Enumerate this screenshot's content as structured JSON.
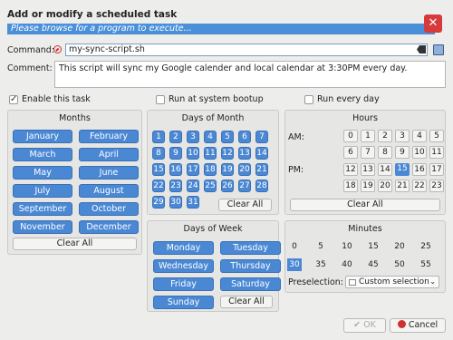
{
  "dialog": {
    "title": "Add or modify a scheduled task",
    "subtitle": "Please browse for a program to execute..."
  },
  "command": {
    "label": "Command:",
    "value": "my-sync-script.sh"
  },
  "comment": {
    "label": "Comment:",
    "value": "This script will sync my Google calender and local calendar at 3:30PM every day."
  },
  "options": {
    "enable": {
      "label": "Enable this task",
      "checked": true
    },
    "bootup": {
      "label": "Run at system bootup",
      "checked": false
    },
    "everyday": {
      "label": "Run every day",
      "checked": false
    }
  },
  "months": {
    "title": "Months",
    "items": [
      "January",
      "February",
      "March",
      "April",
      "May",
      "June",
      "July",
      "August",
      "September",
      "October",
      "November",
      "December"
    ],
    "clear": "Clear All"
  },
  "days_of_month": {
    "title": "Days of Month",
    "items": [
      "1",
      "2",
      "3",
      "4",
      "5",
      "6",
      "7",
      "8",
      "9",
      "10",
      "11",
      "12",
      "13",
      "14",
      "15",
      "16",
      "17",
      "18",
      "19",
      "20",
      "21",
      "22",
      "23",
      "24",
      "25",
      "26",
      "27",
      "28",
      "29",
      "30",
      "31"
    ],
    "clear": "Clear All"
  },
  "days_of_week": {
    "title": "Days of Week",
    "items": [
      "Monday",
      "Tuesday",
      "Wednesday",
      "Thursday",
      "Friday",
      "Saturday",
      "Sunday"
    ],
    "clear": "Clear All"
  },
  "hours": {
    "title": "Hours",
    "am_label": "AM:",
    "pm_label": "PM:",
    "am": [
      "0",
      "1",
      "2",
      "3",
      "4",
      "5",
      "6",
      "7",
      "8",
      "9",
      "10",
      "11"
    ],
    "pm": [
      "12",
      "13",
      "14",
      "15",
      "16",
      "17",
      "18",
      "19",
      "20",
      "21",
      "22",
      "23"
    ],
    "selected": "15",
    "clear": "Clear All"
  },
  "minutes": {
    "title": "Minutes",
    "items": [
      "0",
      "5",
      "10",
      "15",
      "20",
      "25",
      "30",
      "35",
      "40",
      "45",
      "50",
      "55"
    ],
    "selected": "30",
    "preselection_label": "Preselection:",
    "preselection_value": "Custom selection"
  },
  "footer": {
    "ok": "OK",
    "cancel": "Cancel"
  },
  "colors": {
    "accent": "#4a88d4",
    "danger": "#d63a3a"
  }
}
